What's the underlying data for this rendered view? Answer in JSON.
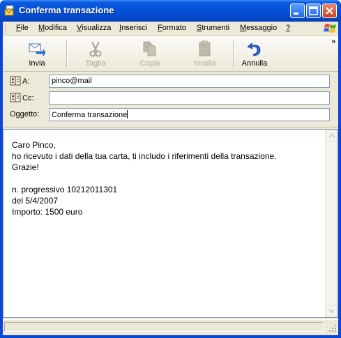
{
  "window": {
    "title": "Conferma transazione"
  },
  "menu": {
    "items": [
      {
        "label": "File",
        "u": "F",
        "rest": "ile"
      },
      {
        "label": "Modifica",
        "u": "M",
        "rest": "odifica"
      },
      {
        "label": "Visualizza",
        "u": "V",
        "rest": "isualizza"
      },
      {
        "label": "Inserisci",
        "u": "I",
        "rest": "nserisci"
      },
      {
        "label": "Formato",
        "u": "F",
        "rest": "ormato"
      },
      {
        "label": "Strumenti",
        "u": "S",
        "rest": "trumenti"
      },
      {
        "label": "Messaggio",
        "u": "M",
        "rest": "essaggio"
      },
      {
        "label": "?",
        "u": "?",
        "rest": ""
      }
    ]
  },
  "toolbar": {
    "send_label": "Invia",
    "cut_label": "Taglia",
    "copy_label": "Copia",
    "paste_label": "Incolla",
    "undo_label": "Annulla",
    "more": "»"
  },
  "header": {
    "to_label": "A:",
    "to_value": "pinco@mail",
    "cc_label": "Cc:",
    "cc_value": "",
    "subject_label": "Oggetto:",
    "subject_value": "Conferma transazione"
  },
  "message": {
    "body": "Caro Pinco,\nho ricevuto i dati della tua carta, ti includo i riferimenti della transazione.\nGrazie!\n\nn. progressivo 10212011301\ndel 5/4/2007\nImporto: 1500 euro"
  },
  "icons": {
    "app": "envelope-doc-icon",
    "send": "send-icon",
    "cut": "scissors-icon",
    "copy": "copy-icon",
    "paste": "paste-icon",
    "undo": "undo-arrow-icon",
    "address_book": "address-book-icon"
  },
  "colors": {
    "titlebar": "#0551d8",
    "face": "#ece9d8",
    "disabled_text": "#aca899",
    "input_border": "#7f9db9"
  }
}
